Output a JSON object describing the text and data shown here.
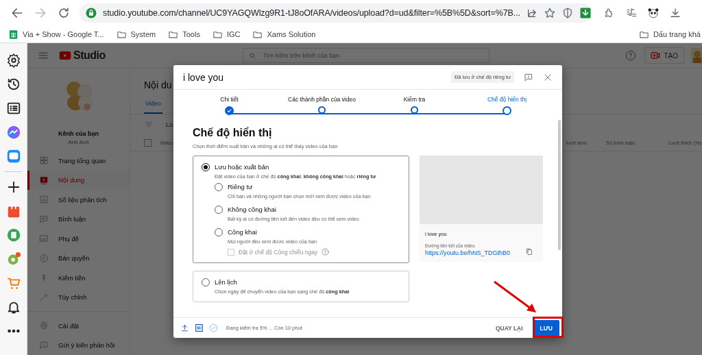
{
  "browser": {
    "address": "studio.youtube.com/channel/UC9YAGQWlzg9R1-tJ8oOfARA/videos/upload?d=ud&filter=%5B%5D&sort=%7B...",
    "bookmarks": [
      {
        "label": "Via + Show - Google T...",
        "kind": "sheet"
      },
      {
        "label": "System",
        "kind": "folder"
      },
      {
        "label": "Tools",
        "kind": "folder"
      },
      {
        "label": "IGC",
        "kind": "folder"
      },
      {
        "label": "Xams Solution",
        "kind": "folder"
      }
    ],
    "other_bookmarks": "Dấu trang khá"
  },
  "studio": {
    "logo": "Studio",
    "search": {
      "placeholder": "Tìm kiếm trên kênh của bạn"
    },
    "create_button": "TẠO",
    "channel": {
      "title": "Kênh của bạn",
      "name": "Anh Anh"
    },
    "nav": [
      {
        "label": "Trang tổng quan",
        "selected": false
      },
      {
        "label": "Nội dung",
        "selected": true
      },
      {
        "label": "Số liệu phân tích",
        "selected": false
      },
      {
        "label": "Bình luận",
        "selected": false
      },
      {
        "label": "Phụ đề",
        "selected": false
      },
      {
        "label": "Bản quyền",
        "selected": false
      },
      {
        "label": "Kiếm tiền",
        "selected": false
      },
      {
        "label": "Tùy chỉnh",
        "selected": false
      }
    ],
    "footer_nav": [
      {
        "label": "Cài đặt"
      },
      {
        "label": "Gửi ý kiến phản hồi"
      }
    ],
    "page_title": "Nội du",
    "tabs": [
      {
        "label": "Video",
        "selected": true
      }
    ],
    "filter_text": "Lo",
    "select_all": {
      "checked": false
    },
    "columns": [
      "Video",
      "lượt xem",
      "Số bình luận",
      "Lượt thích (%)"
    ]
  },
  "dialog": {
    "title": "i love you",
    "save_status": "Đã lưu ở chế độ riêng tư",
    "steps": [
      {
        "label": "Chi tiết",
        "done": true,
        "selected": false
      },
      {
        "label": "Các thành phần của video",
        "done": false,
        "selected": false
      },
      {
        "label": "Kiểm tra",
        "done": false,
        "selected": false
      },
      {
        "label": "Chế độ hiển thị",
        "done": false,
        "selected": true
      }
    ],
    "heading": "Chế độ hiển thị",
    "subtitle": "Chọn thời điểm xuất bản và những ai có thể thấy video của bạn",
    "options": [
      {
        "label": "Lưu hoặc xuất bản",
        "description": "Đặt video của bạn ở chế độ **công khai**, **không công khai** hoặc **riêng tư**",
        "selected": true,
        "children": [
          {
            "label": "Riêng tư",
            "description": "Chỉ bạn và những người bạn chọn mới xem được video của bạn",
            "selected": false
          },
          {
            "label": "Không công khai",
            "description": "Bất kỳ ai có đường liên kết đến video đều có thể xem video",
            "selected": false
          },
          {
            "label": "Công khai",
            "description": "Mọi người đều xem được video của bạn",
            "selected": false,
            "premiere": {
              "label": "Đặt ở chế độ Công chiếu ngay",
              "checked": false,
              "disabled": true
            }
          }
        ]
      },
      {
        "label": "Lên lịch",
        "description": "Chọn ngày để chuyển video của bạn sang chế độ **công khai**",
        "selected": false
      }
    ],
    "preview": {
      "title": "i love you",
      "link_label": "Đường liên kết của video",
      "link": "https://youtu.be/hNS_TDGthB0"
    },
    "status": "Đang kiểm tra 5% ... Còn 10 phút",
    "back_button": "QUAY LẠI",
    "save_button": "LƯU"
  }
}
